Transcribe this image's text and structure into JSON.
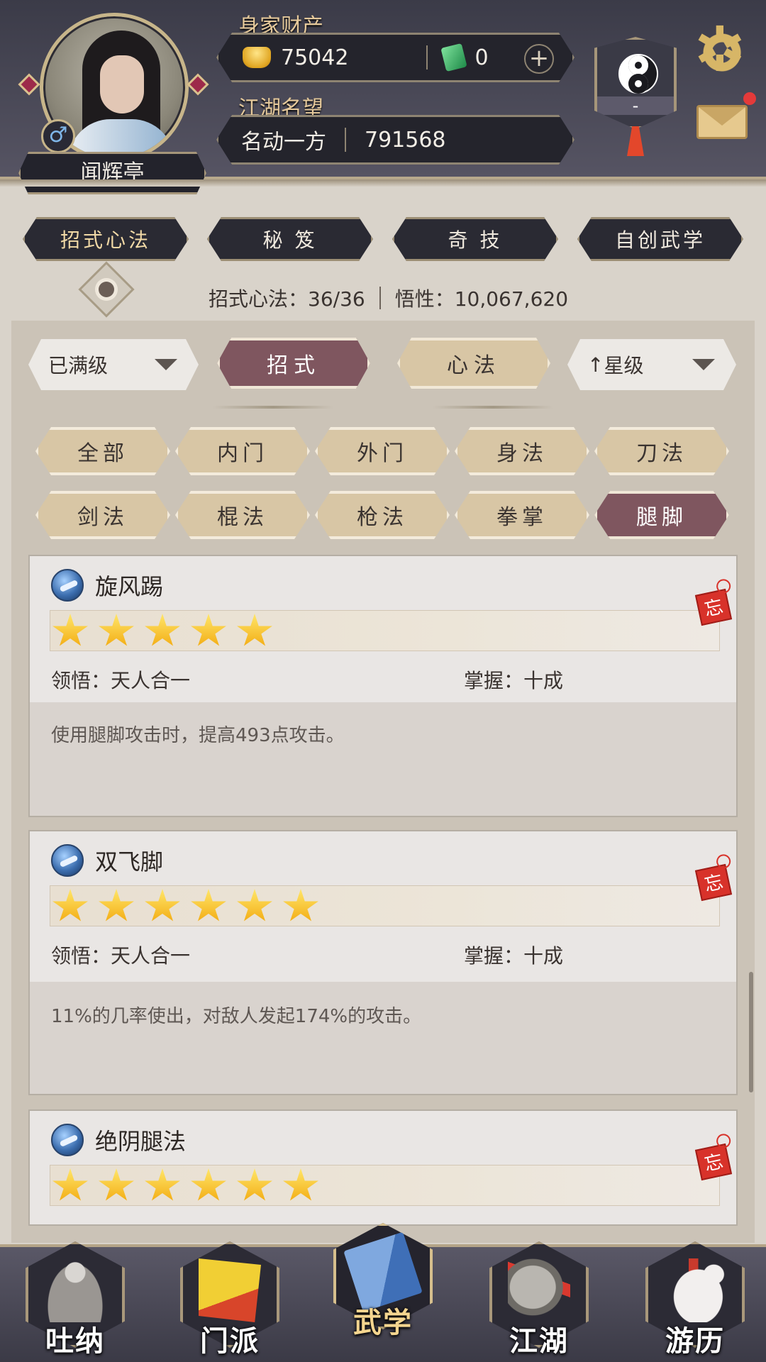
{
  "player": {
    "name": "闻辉亭",
    "gender_symbol": "♂"
  },
  "wealth": {
    "label": "身家财产",
    "gold": "75042",
    "jade": "0",
    "add_symbol": "+"
  },
  "reputation": {
    "label": "江湖名望",
    "title": "名动一方",
    "value": "791568"
  },
  "sect_banner": {
    "value": "-"
  },
  "tabs": [
    {
      "label": "招式心法",
      "active": true
    },
    {
      "label": "秘 笈",
      "active": false
    },
    {
      "label": "奇 技",
      "active": false
    },
    {
      "label": "自创武学",
      "active": false
    }
  ],
  "stats": {
    "skills": "招式心法：36/36",
    "comprehension": "悟性：10,067,620"
  },
  "filters": {
    "level_dropdown": "已满级",
    "type_tabs": [
      {
        "label": "招式",
        "active": true
      },
      {
        "label": "心法",
        "active": false
      }
    ],
    "sort_dropdown": "星级",
    "sort_arrow": "↑"
  },
  "categories": [
    {
      "label": "全部",
      "active": false
    },
    {
      "label": "内门",
      "active": false
    },
    {
      "label": "外门",
      "active": false
    },
    {
      "label": "身法",
      "active": false
    },
    {
      "label": "刀法",
      "active": false
    },
    {
      "label": "剑法",
      "active": false
    },
    {
      "label": "棍法",
      "active": false
    },
    {
      "label": "枪法",
      "active": false
    },
    {
      "label": "拳掌",
      "active": false
    },
    {
      "label": "腿脚",
      "active": true
    }
  ],
  "skills": [
    {
      "name": "旋风踢",
      "stars": 5,
      "comprehend_label": "领悟：",
      "comprehend_value": "天人合一",
      "mastery_label": "掌握：",
      "mastery_value": "十成",
      "description": "使用腿脚攻击时，提高493点攻击。",
      "seal": "忘"
    },
    {
      "name": "双飞脚",
      "stars": 6,
      "comprehend_label": "领悟：",
      "comprehend_value": "天人合一",
      "mastery_label": "掌握：",
      "mastery_value": "十成",
      "description": "11%的几率使出，对敌人发起174%的攻击。",
      "seal": "忘"
    },
    {
      "name": "绝阴腿法",
      "stars": 6,
      "seal": "忘"
    }
  ],
  "bottom_nav": [
    {
      "label": "吐纳",
      "icon": "meditating-figure-icon",
      "active": false
    },
    {
      "label": "门派",
      "icon": "sect-flag-icon",
      "active": false
    },
    {
      "label": "武学",
      "icon": "martial-book-icon",
      "active": true
    },
    {
      "label": "江湖",
      "icon": "bamboo-hat-icon",
      "active": false
    },
    {
      "label": "游历",
      "icon": "horse-icon",
      "active": false
    }
  ],
  "colors": {
    "header_bg": "#4a4957",
    "active_tab": "#7f565f",
    "inactive_chip": "#d8c6a5",
    "gold_text": "#e5c99b",
    "star_gold": "#f2a90e"
  }
}
